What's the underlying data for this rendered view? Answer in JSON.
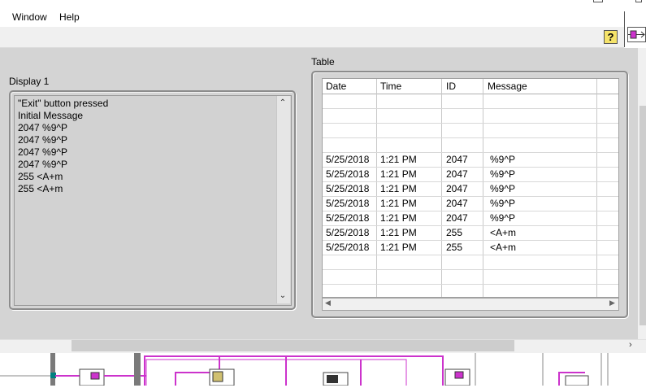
{
  "menu": {
    "items": [
      "Window",
      "Help"
    ]
  },
  "help_button_label": "?",
  "display": {
    "label": "Display 1",
    "lines": [
      "\"Exit\" button pressed",
      "Initial Message",
      "2047 %9^P",
      "2047 %9^P",
      "2047 %9^P",
      "2047 %9^P",
      "255 <A+m",
      "255 <A+m"
    ]
  },
  "table": {
    "label": "Table",
    "headers": [
      "Date",
      "Time",
      "ID",
      "Message"
    ],
    "rows": [
      [
        "",
        "",
        "",
        ""
      ],
      [
        "",
        "",
        "",
        ""
      ],
      [
        "",
        "",
        "",
        ""
      ],
      [
        "",
        "",
        "",
        ""
      ],
      [
        "5/25/2018",
        "1:21 PM",
        "2047",
        "%9^P"
      ],
      [
        "5/25/2018",
        "1:21 PM",
        "2047",
        "%9^P"
      ],
      [
        "5/25/2018",
        "1:21 PM",
        "2047",
        "%9^P"
      ],
      [
        "5/25/2018",
        "1:21 PM",
        "2047",
        "%9^P"
      ],
      [
        "5/25/2018",
        "1:21 PM",
        "2047",
        "%9^P"
      ],
      [
        "5/25/2018",
        "1:21 PM",
        "255",
        "<A+m"
      ],
      [
        "5/25/2018",
        "1:21 PM",
        "255",
        "<A+m"
      ],
      [
        "",
        "",
        "",
        ""
      ],
      [
        "",
        "",
        "",
        ""
      ]
    ]
  },
  "colors": {
    "panel": "#d4d4d4",
    "wire_pink": "#cc33cc",
    "help_yellow": "#f5e36a"
  },
  "icons": [
    "help-icon",
    "connector-pane-icon",
    "scroll-up-arrow-icon",
    "scroll-down-arrow-icon",
    "scroll-left-arrow-icon",
    "scroll-right-arrow-icon"
  ]
}
